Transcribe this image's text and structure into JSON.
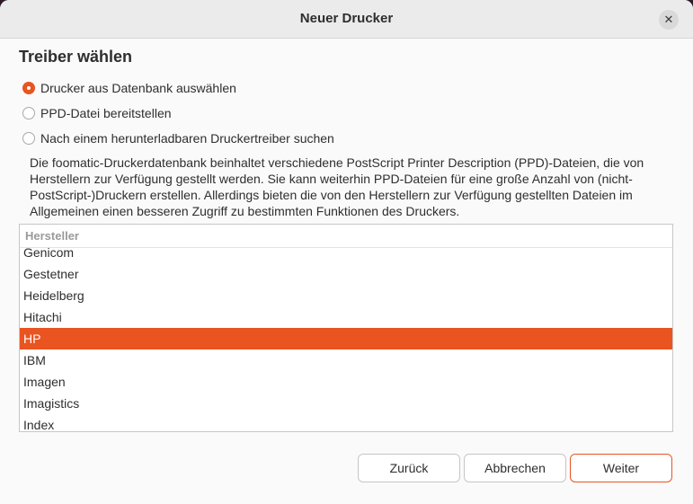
{
  "window": {
    "title": "Neuer Drucker",
    "close_symbol": "✕"
  },
  "page": {
    "heading": "Treiber wählen",
    "options": [
      {
        "label": "Drucker aus Datenbank auswählen",
        "checked": true
      },
      {
        "label": "PPD-Datei bereitstellen",
        "checked": false
      },
      {
        "label": "Nach einem herunterladbaren Druckertreiber suchen",
        "checked": false
      }
    ],
    "description": "Die foomatic-Druckerdatenbank beinhaltet verschiedene PostScript Printer Description (PPD)-Dateien, die von Herstellern zur Verfügung gestellt werden. Sie kann weiterhin PPD-Dateien für eine große Anzahl von (nicht-PostScript-)Druckern erstellen. Allerdings bieten die von den Herstellern zur Verfügung gestellten Dateien im Allgemeinen einen besseren Zugriff zu bestimmten Funktionen des Druckers."
  },
  "list": {
    "header": "Hersteller",
    "items": [
      "Genicom",
      "Gestetner",
      "Heidelberg",
      "Hitachi",
      "HP",
      "IBM",
      "Imagen",
      "Imagistics",
      "Index"
    ],
    "selected": "HP"
  },
  "buttons": {
    "back": "Zurück",
    "cancel": "Abbrechen",
    "next": "Weiter"
  },
  "colors": {
    "accent": "#e95420"
  }
}
